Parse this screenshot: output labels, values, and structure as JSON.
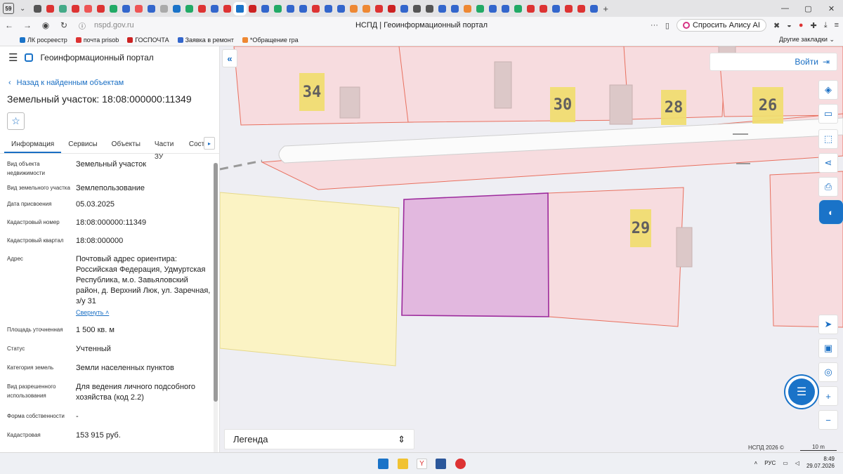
{
  "browser": {
    "tab_count": "59",
    "url": "nspd.gov.ru",
    "page_title": "НСПД | Геоинформационный портал",
    "alice_label": "Спросить Алису AI",
    "bookmarks": [
      "ЛК росреестр",
      "почта prisob",
      "ГОСПОЧТА",
      "Заявка в ремонт",
      "*Обращение гра"
    ],
    "other_bookmarks": "Другие закладки"
  },
  "sidebar": {
    "portal_name": "Геоинформационный портал",
    "back_link": "Назад к найденным объектам",
    "title": "Земельный участок: 18:08:000000:11349",
    "tabs": [
      "Информация",
      "Сервисы",
      "Объекты",
      "Части ЗУ",
      "Состав"
    ],
    "properties": [
      {
        "label": "Вид объекта недвижимости",
        "value": "Земельный участок"
      },
      {
        "label": "Вид земельного участка",
        "value": "Землепользование"
      },
      {
        "label": "Дата присвоения",
        "value": "05.03.2025"
      },
      {
        "label": "Кадастровый номер",
        "value": "18:08:000000:11349"
      },
      {
        "label": "Кадастровый квартал",
        "value": "18:08:000000"
      },
      {
        "label": "Адрес",
        "value": "Почтовый адрес ориентира: Российская Федерация, Удмуртская Республика, м.о. Завьяловский район, д. Верхний Люк, ул. Заречная, з/у 31"
      },
      {
        "label": "Площадь уточненная",
        "value": "1 500 кв. м"
      },
      {
        "label": "Статус",
        "value": "Учтенный"
      },
      {
        "label": "Категория земель",
        "value": "Земли населенных пунктов"
      },
      {
        "label": "Вид разрешенного использования",
        "value": "Для ведения личного подсобного хозяйства (код 2.2)"
      },
      {
        "label": "Форма собственности",
        "value": "-"
      },
      {
        "label": "Кадастровая",
        "value": "153 915 руб."
      }
    ],
    "collapse_link": "Свернуть"
  },
  "map": {
    "login": "Войти",
    "house_numbers": [
      "34",
      "30",
      "28",
      "26",
      "29"
    ],
    "legend_label": "Легенда",
    "attribution": "НСПД 2026 ©",
    "scale": "10 m",
    "colors": {
      "parcel_fill": "#f7dcdf",
      "parcel_stroke": "#e8705f",
      "selected_fill": "#e2b8df",
      "selected_stroke": "#9c2a9c",
      "yellow_fill": "#fbf3c4",
      "accent": "#1a73c8"
    }
  },
  "taskbar": {
    "lang": "РУС",
    "time": "8:49",
    "date": "29.07.2026"
  }
}
